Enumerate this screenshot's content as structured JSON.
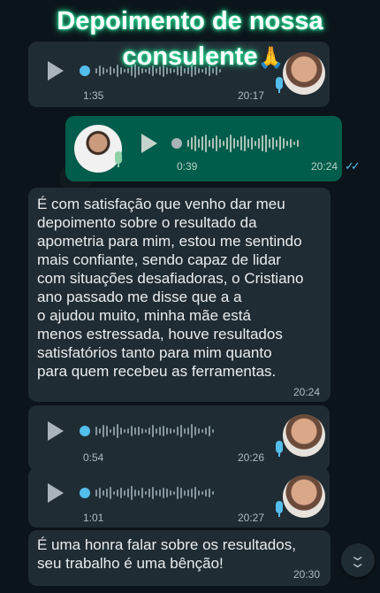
{
  "overlay": {
    "title_line1": "Depoimento de nossa",
    "title_line2": "consulente",
    "emoji": "🙏"
  },
  "messages": [
    {
      "kind": "voice",
      "direction": "in",
      "duration": "1:35",
      "time": "20:17"
    },
    {
      "kind": "voice",
      "direction": "out",
      "duration": "0:39",
      "time": "20:24",
      "status": "read"
    },
    {
      "kind": "text",
      "direction": "in",
      "text": "É com satisfação que venho dar meu\ndepoimento sobre o resultado da\napometria para mim, estou me sentindo\nmais confiante, sendo capaz de lidar\ncom situações desafiadoras, o Cristiano\nano passado me disse que a a\no ajudou muito, minha mãe está\nmenos estressada, houve resultados\nsatisfatórios tanto para mim quanto\npara quem recebeu as ferramentas.",
      "time": "20:24"
    },
    {
      "kind": "voice",
      "direction": "in",
      "duration": "0:54",
      "time": "20:26"
    },
    {
      "kind": "voice",
      "direction": "in",
      "duration": "1:01",
      "time": "20:27"
    },
    {
      "kind": "text",
      "direction": "in",
      "text": "É uma honra falar sobre os resultados,\nseu trabalho é uma bênção!",
      "time": "20:30"
    }
  ],
  "icons": {
    "play": "play-icon",
    "mic": "microphone-icon",
    "read": "double-check-icon",
    "scroll": "chevron-double-down-icon"
  },
  "colors": {
    "background": "#0b141a",
    "incoming_bubble": "#202c33",
    "outgoing_bubble": "#005c4b",
    "voice_progress": "#53bdeb",
    "glow": "#2ee89c"
  }
}
